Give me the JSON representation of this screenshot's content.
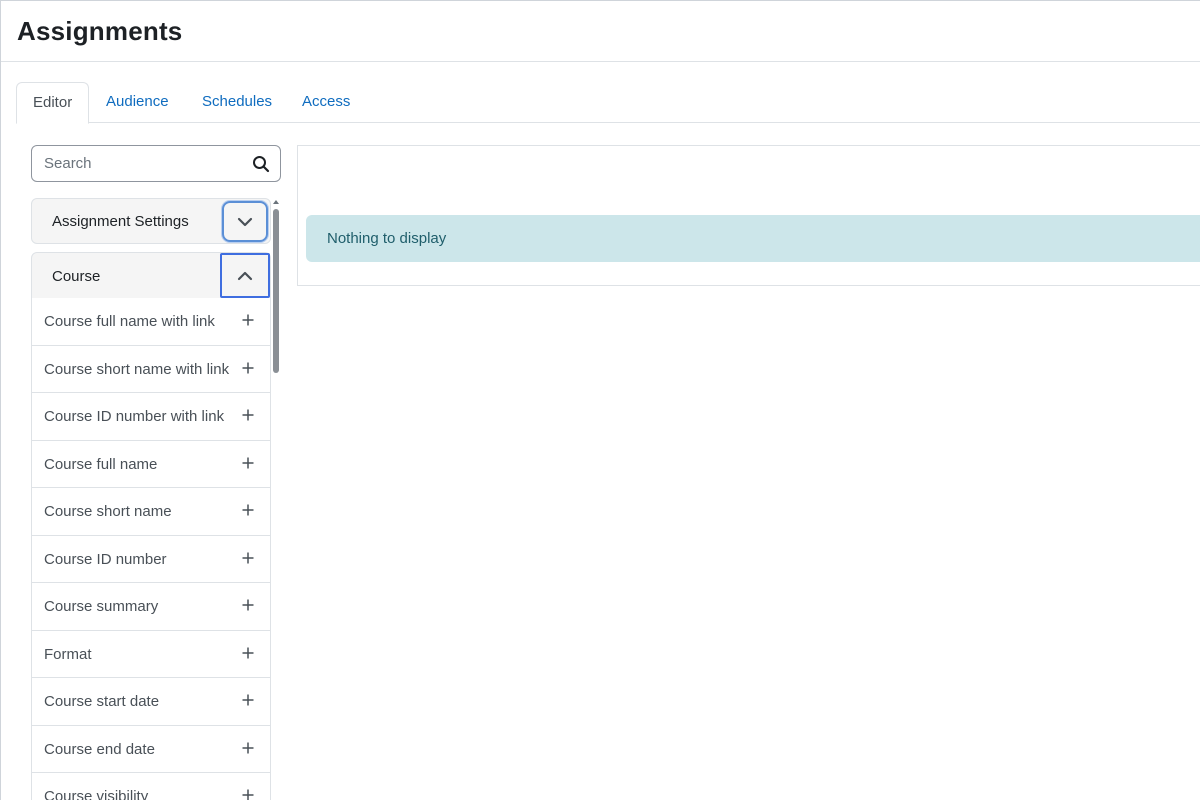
{
  "page": {
    "title": "Assignments"
  },
  "tabs": [
    {
      "label": "Editor",
      "active": true
    },
    {
      "label": "Audience",
      "active": false
    },
    {
      "label": "Schedules",
      "active": false
    },
    {
      "label": "Access",
      "active": false
    }
  ],
  "search": {
    "placeholder": "Search",
    "value": "",
    "icon": "search-icon"
  },
  "sidebar": {
    "groups": [
      {
        "title": "Assignment Settings",
        "toggle_icon": "chevron-down-icon",
        "expanded": false
      },
      {
        "title": "Course",
        "toggle_icon": "chevron-up-icon",
        "expanded": true
      }
    ],
    "items": [
      {
        "label": "Course full name with link"
      },
      {
        "label": "Course short name with link"
      },
      {
        "label": "Course ID number with link"
      },
      {
        "label": "Course full name"
      },
      {
        "label": "Course short name"
      },
      {
        "label": "Course ID number"
      },
      {
        "label": "Course summary"
      },
      {
        "label": "Format"
      },
      {
        "label": "Course start date"
      },
      {
        "label": "Course end date"
      },
      {
        "label": "Course visibility"
      }
    ],
    "item_action_icon": "plus-icon"
  },
  "main": {
    "empty_message": "Nothing to display"
  },
  "colors": {
    "link": "#0f6cbf",
    "alert_background": "#cce6ea",
    "alert_text": "#1f5e6b",
    "focus_ring": "#3f6ee0"
  }
}
